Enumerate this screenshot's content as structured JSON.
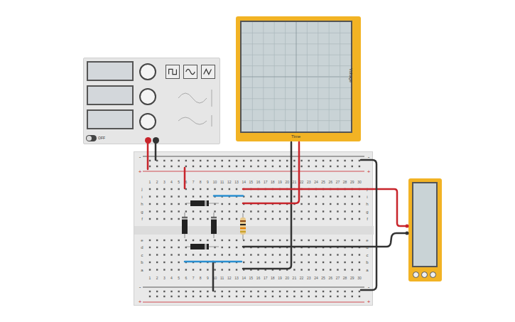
{
  "function_generator": {
    "power": {
      "label": "OFF",
      "on": false
    }
  },
  "oscilloscope": {
    "y_label": "Voltage",
    "x_label": "Time"
  },
  "breadboard": {
    "columns": [
      "1",
      "2",
      "3",
      "4",
      "5",
      "6",
      "7",
      "8",
      "9",
      "10",
      "11",
      "12",
      "13",
      "14",
      "15",
      "16",
      "17",
      "18",
      "19",
      "20",
      "21",
      "22",
      "23",
      "24",
      "25",
      "26",
      "27",
      "28",
      "29",
      "30"
    ],
    "rows_top": [
      "j",
      "i",
      "h",
      "g",
      "f"
    ],
    "rows_bottom": [
      "e",
      "d",
      "c",
      "b",
      "a"
    ],
    "rail_signs": {
      "plus": "+",
      "minus": "-"
    }
  }
}
